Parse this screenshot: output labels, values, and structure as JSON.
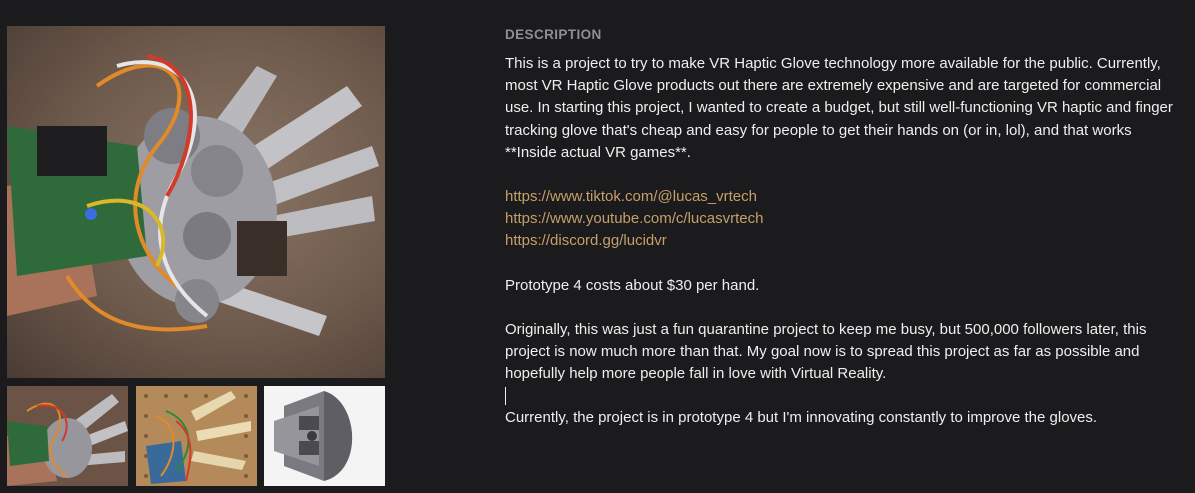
{
  "gallery": {
    "main_image": {
      "icon": "vr-haptic-glove-photo"
    },
    "thumbnails": [
      {
        "icon": "glove-photo-thumbnail"
      },
      {
        "icon": "pegboard-prototype-thumbnail"
      },
      {
        "icon": "cad-model-thumbnail"
      }
    ]
  },
  "description": {
    "heading": "DESCRIPTION",
    "intro": "This is a project to try to make VR Haptic Glove technology more available for the public. Currently, most VR Haptic Glove products out there are extremely expensive and are targeted for commercial use. In starting this project, I wanted to create a budget, but still well-functioning VR haptic and finger tracking glove that's cheap and easy for people to get their hands on (or in, lol), and that works **Inside actual VR games**.",
    "links": [
      "https://www.tiktok.com/@lucas_vrtech",
      "https://www.youtube.com/c/lucasvrtech",
      "https://discord.gg/lucidvr"
    ],
    "cost": "Prototype 4 costs about $30 per hand.",
    "story": "Originally, this was just a fun quarantine project to keep me busy, but 500,000 followers later, this project is now much more than that. My goal now is to spread this project as far as possible and hopefully help more people fall in love with Virtual Reality.",
    "status": "Currently, the project is in prototype 4 but I'm innovating constantly to improve the gloves."
  },
  "colors": {
    "background": "#1b1a1c",
    "heading": "#8f8f8f",
    "text": "#efefef",
    "link": "#c4a06a"
  }
}
